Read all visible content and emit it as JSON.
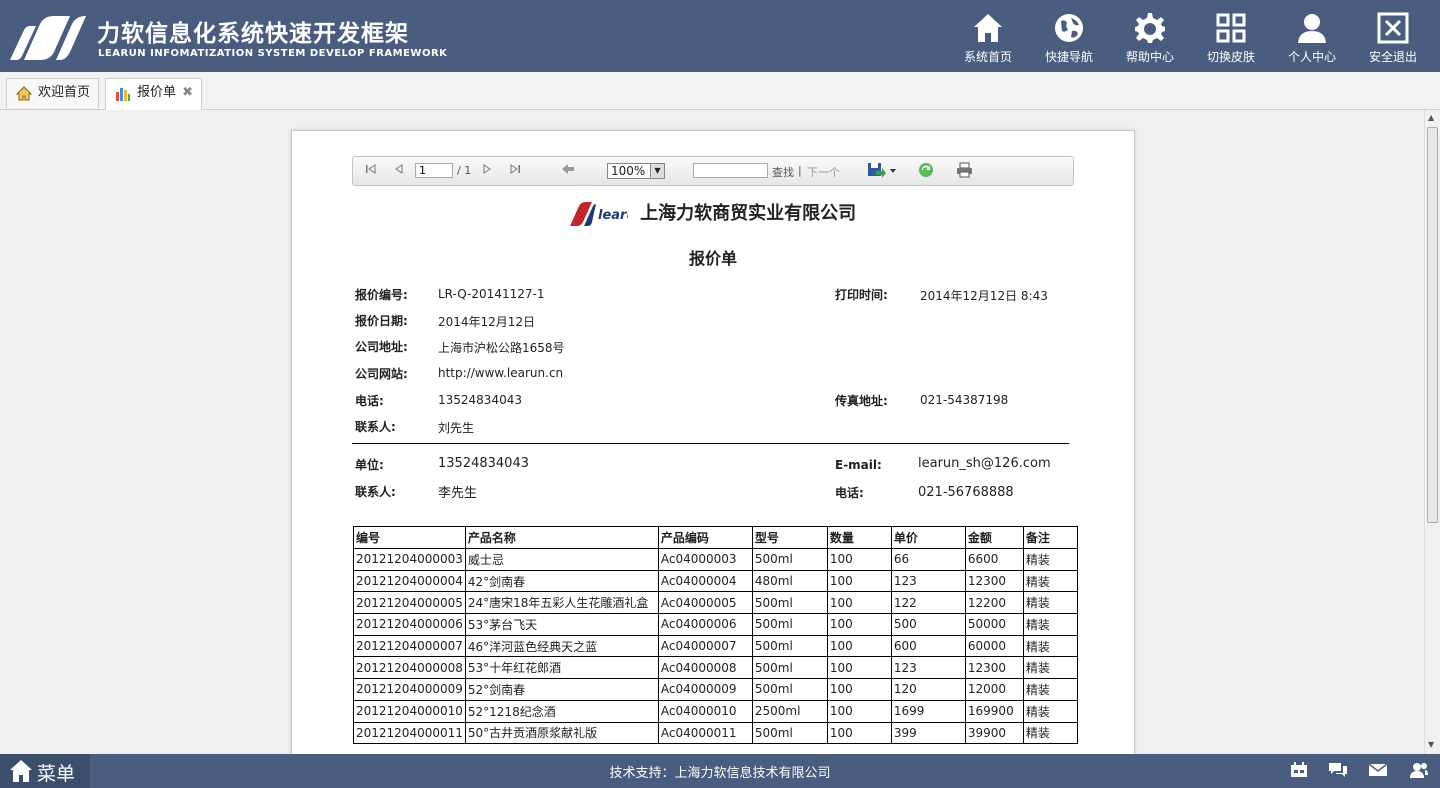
{
  "header": {
    "title_cn": "力软信息化系统快速开发框架",
    "title_en": "LEARUN INFOMATIZATION SYSTEM DEVELOP FRAMEWORK",
    "nav": [
      {
        "icon": "home-icon",
        "label": "系统首页"
      },
      {
        "icon": "globe-icon",
        "label": "快捷导航"
      },
      {
        "icon": "gear-icon",
        "label": "帮助中心"
      },
      {
        "icon": "grid-icon",
        "label": "切换皮肤"
      },
      {
        "icon": "user-icon",
        "label": "个人中心"
      },
      {
        "icon": "close-box-icon",
        "label": "安全退出"
      }
    ]
  },
  "tabs": [
    {
      "icon": "home-small-icon",
      "label": "欢迎首页"
    },
    {
      "icon": "chart-small-icon",
      "label": "报价单",
      "close": "✖"
    }
  ],
  "report_toolbar": {
    "page_current": "1",
    "page_total": "/ 1",
    "zoom": "100%",
    "search_placeholder": "",
    "find_label": "查找",
    "next_label": "下一个",
    "separator": "|"
  },
  "report": {
    "logo_text": "learun",
    "company": "上海力软商贸实业有限公司",
    "title": "报价单",
    "fields": {
      "quote_no_label": "报价编号:",
      "quote_no": "LR-Q-20141127-1",
      "print_time_label": "打印时间:",
      "print_time": "2014年12月12日 8:43",
      "quote_date_label": "报价日期:",
      "quote_date": "2014年12月12日",
      "address_label": "公司地址:",
      "address": "上海市沪松公路1658号",
      "website_label": "公司网站:",
      "website": "http://www.learun.cn",
      "phone_label": "电话:",
      "phone": "13524834043",
      "fax_label": "传真地址:",
      "fax": "021-54387198",
      "contact_label": "联系人:",
      "contact": "刘先生"
    },
    "customer": {
      "unit_label": "单位:",
      "unit": "13524834043",
      "email_label": "E-mail:",
      "email": "learun_sh@126.com",
      "contact_label": "联系人:",
      "contact": "李先生",
      "phone_label": "电话:",
      "phone": "021-56768888"
    },
    "table": {
      "headers": [
        "编号",
        "产品名称",
        "产品编码",
        "型号",
        "数量",
        "单价",
        "金额",
        "备注"
      ],
      "rows": [
        [
          "20121204000003",
          "威士忌",
          "Ac04000003",
          "500ml",
          "100",
          "66",
          "6600",
          "精装"
        ],
        [
          "20121204000004",
          "42°剑南春",
          "Ac04000004",
          "480ml",
          "100",
          "123",
          "12300",
          "精装"
        ],
        [
          "20121204000005",
          "24°唐宋18年五彩人生花雕酒礼盒",
          "Ac04000005",
          "500ml",
          "100",
          "122",
          "12200",
          "精装"
        ],
        [
          "20121204000006",
          "53°茅台飞天",
          "Ac04000006",
          "500ml",
          "100",
          "500",
          "50000",
          "精装"
        ],
        [
          "20121204000007",
          "46°洋河蓝色经典天之蓝",
          "Ac04000007",
          "500ml",
          "100",
          "600",
          "60000",
          "精装"
        ],
        [
          "20121204000008",
          "53°十年红花郎酒",
          "Ac04000008",
          "500ml",
          "100",
          "123",
          "12300",
          "精装"
        ],
        [
          "20121204000009",
          "52°剑南春",
          "Ac04000009",
          "500ml",
          "100",
          "120",
          "12000",
          "精装"
        ],
        [
          "20121204000010",
          "52°1218纪念酒",
          "Ac04000010",
          "2500ml",
          "100",
          "1699",
          "169900",
          "精装"
        ],
        [
          "20121204000011",
          "50°古井贡酒原浆献礼版",
          "Ac04000011",
          "500ml",
          "100",
          "399",
          "39900",
          "精装"
        ]
      ]
    }
  },
  "footer": {
    "menu_label": "菜单",
    "support": "技术支持：上海力软信息技术有限公司",
    "icons": [
      "calendar-icon",
      "chat-icon",
      "mail-icon",
      "users-icon"
    ]
  },
  "colors": {
    "header_bg": "#4a5d7e",
    "footer_bg": "#4a5d7e"
  }
}
